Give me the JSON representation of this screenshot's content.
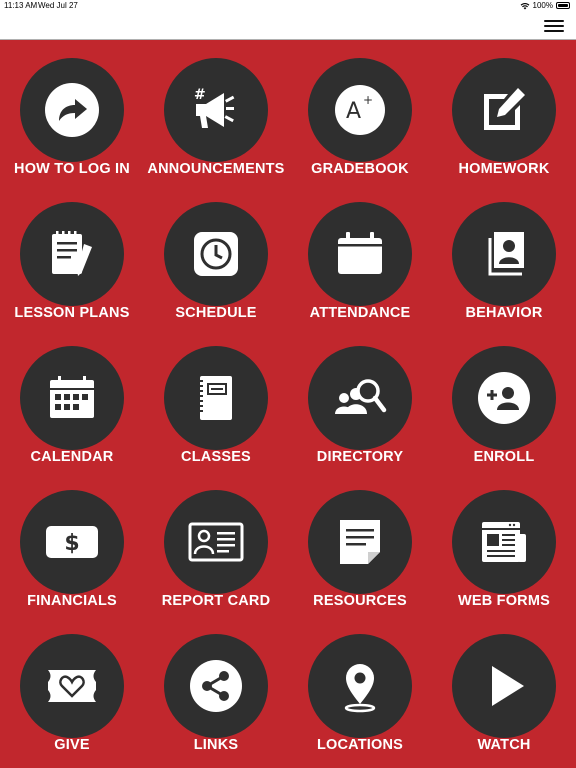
{
  "status_bar": {
    "time": "11:13 AM",
    "date": "Wed Jul 27",
    "battery": "100%"
  },
  "nav": {
    "menu_icon": "hamburger-menu-icon"
  },
  "colors": {
    "background": "#c1272d",
    "circle": "#2f2f2f",
    "label": "#ffffff",
    "nav_bar": "#ffffff"
  },
  "tiles": [
    {
      "label": "HOW TO LOG IN",
      "icon": "share-arrow-icon"
    },
    {
      "label": "ANNOUNCEMENTS",
      "icon": "megaphone-icon"
    },
    {
      "label": "GRADEBOOK",
      "icon": "a-plus-grade-icon"
    },
    {
      "label": "HOMEWORK",
      "icon": "pencil-square-icon"
    },
    {
      "label": "LESSON PLANS",
      "icon": "notepad-pen-icon"
    },
    {
      "label": "SCHEDULE",
      "icon": "clock-icon"
    },
    {
      "label": "ATTENDANCE",
      "icon": "calendar-icon"
    },
    {
      "label": "BEHAVIOR",
      "icon": "contact-cards-icon"
    },
    {
      "label": "CALENDAR",
      "icon": "calendar-grid-icon"
    },
    {
      "label": "CLASSES",
      "icon": "notebook-icon"
    },
    {
      "label": "DIRECTORY",
      "icon": "people-search-icon"
    },
    {
      "label": "ENROLL",
      "icon": "add-user-icon"
    },
    {
      "label": "FINANCIALS",
      "icon": "dollar-bill-icon"
    },
    {
      "label": "REPORT CARD",
      "icon": "id-card-icon"
    },
    {
      "label": "RESOURCES",
      "icon": "document-icon"
    },
    {
      "label": "WEB FORMS",
      "icon": "newspaper-icon"
    },
    {
      "label": "GIVE",
      "icon": "heart-ticket-icon"
    },
    {
      "label": "LINKS",
      "icon": "share-nodes-icon"
    },
    {
      "label": "LOCATIONS",
      "icon": "map-pin-icon"
    },
    {
      "label": "WATCH",
      "icon": "play-icon"
    }
  ]
}
